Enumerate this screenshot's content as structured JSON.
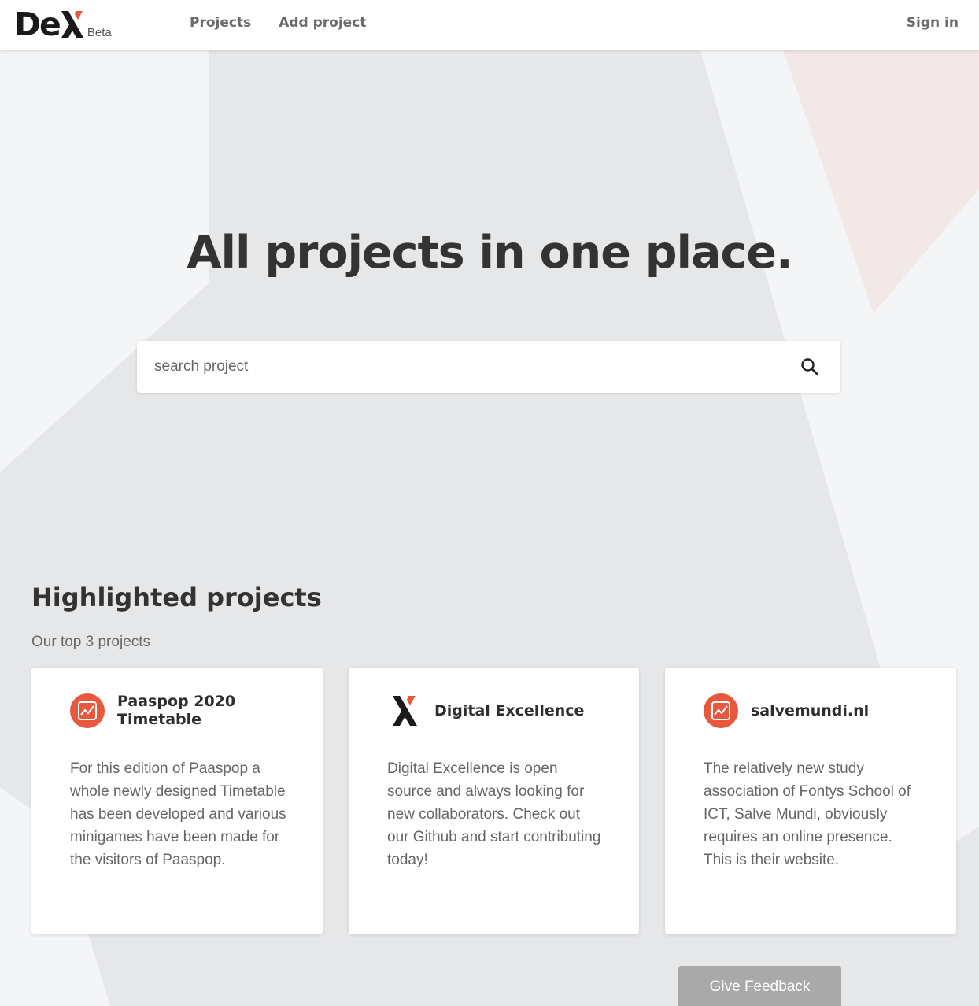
{
  "header": {
    "logo_text": "De",
    "logo_badge": "Beta",
    "nav": [
      {
        "label": "Projects"
      },
      {
        "label": "Add project"
      }
    ],
    "signin_label": "Sign in"
  },
  "hero": {
    "title": "All projects in one place.",
    "search_placeholder": "search project"
  },
  "highlighted": {
    "title": "Highlighted projects",
    "subtitle": "Our top 3 projects",
    "cards": [
      {
        "title": "Paaspop 2020 Timetable",
        "icon": "image-placeholder-icon",
        "description": "For this edition of Paaspop a whole newly designed Timetable has been developed and various minigames have been made for the visitors of Paaspop."
      },
      {
        "title": "Digital Excellence",
        "icon": "dex-logo-icon",
        "description": "Digital Excellence is open source and always looking for new collaborators. Check out our Github and start contributing today!"
      },
      {
        "title": "salvemundi.nl",
        "icon": "image-placeholder-icon",
        "description": "The relatively new study association of Fontys School of ICT, Salve Mundi, obviously requires an online presence. This is their website."
      }
    ]
  },
  "feedback_label": "Give Feedback",
  "colors": {
    "accent": "#e8583d",
    "text_dark": "#333333",
    "text_muted": "#666666",
    "feedback_bg": "#a9a9a9"
  }
}
